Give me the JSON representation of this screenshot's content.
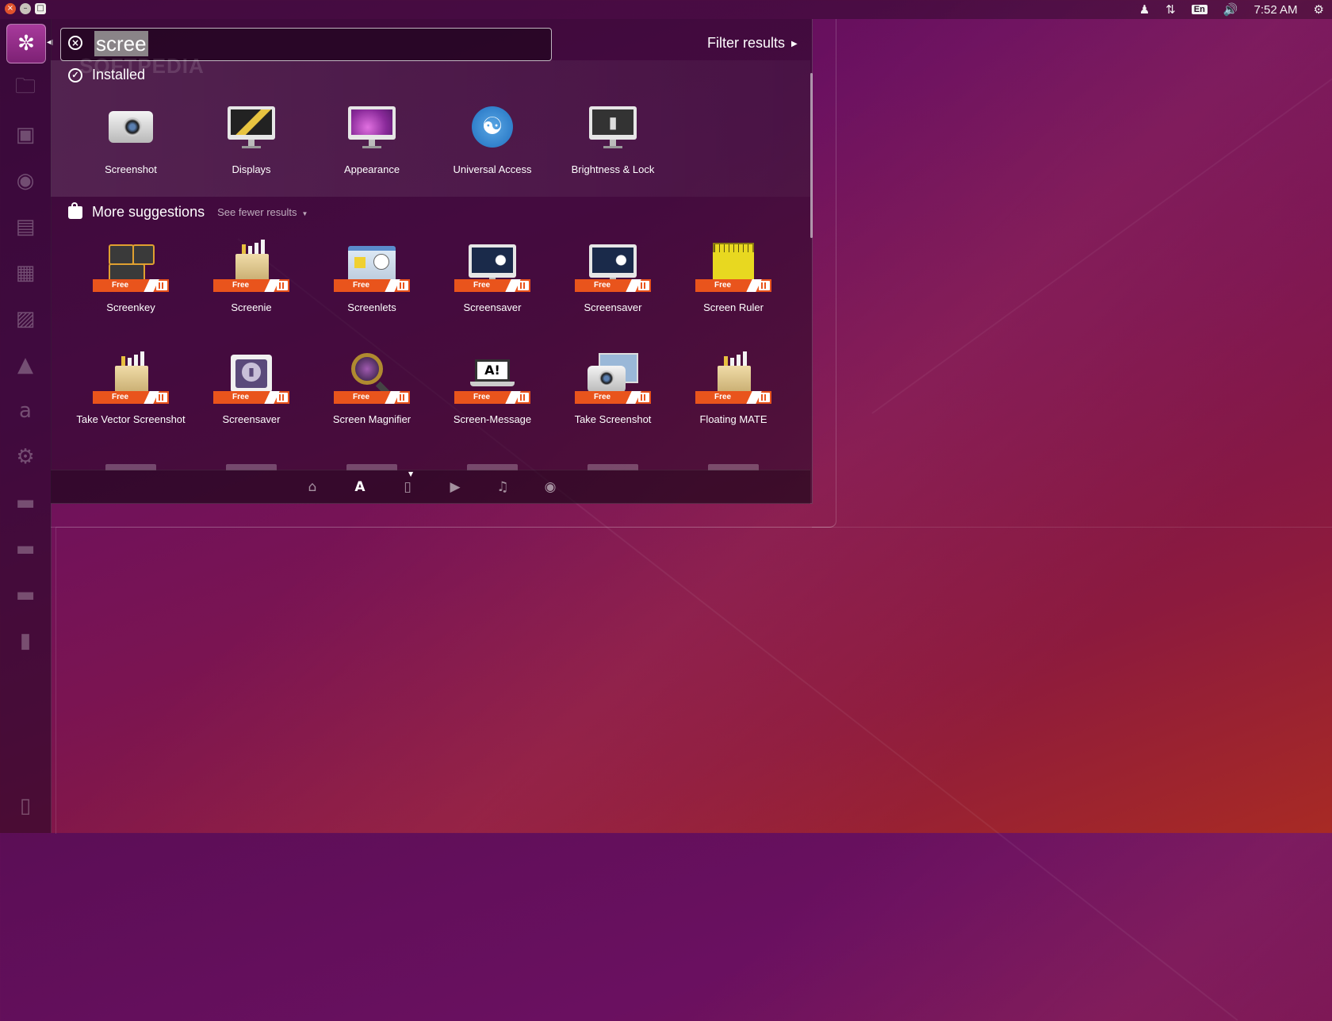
{
  "top_panel": {
    "clock": "7:52 AM",
    "keyboard_layout": "En",
    "indicators": [
      "user-icon",
      "network-icon",
      "keyboard-layout",
      "volume-icon",
      "clock",
      "session-gear-icon"
    ]
  },
  "launcher": {
    "items": [
      "ubuntu-dash-icon",
      "files-icon",
      "browser-icon",
      "firefox-icon",
      "writer-icon",
      "calc-icon",
      "impress-icon",
      "software-center-icon",
      "amazon-icon",
      "system-settings-icon",
      "drive-icon",
      "drive-icon",
      "drive-icon",
      "usb-icon",
      "trash-icon"
    ],
    "amazon_glyph": "a"
  },
  "dash": {
    "search_value": "scree",
    "filter_results_label": "Filter results",
    "watermark": "SOFTPEDIA",
    "installed": {
      "header": "Installed",
      "apps": [
        {
          "label": "Screenshot",
          "icon": "camera-icon"
        },
        {
          "label": "Displays",
          "icon": "displays-icon"
        },
        {
          "label": "Appearance",
          "icon": "appearance-icon"
        },
        {
          "label": "Universal Access",
          "icon": "universal-access-icon"
        },
        {
          "label": "Brightness & Lock",
          "icon": "brightness-lock-icon"
        }
      ]
    },
    "suggestions": {
      "header": "More suggestions",
      "see_fewer": "See fewer results",
      "free_label": "Free",
      "row1": [
        {
          "label": "Screenkey",
          "icon": "screenkey-icon"
        },
        {
          "label": "Screenie",
          "icon": "package-icon"
        },
        {
          "label": "Screenlets",
          "icon": "screenlets-icon"
        },
        {
          "label": "Screensaver",
          "icon": "screensaver-icon"
        },
        {
          "label": "Screensaver",
          "icon": "screensaver-icon"
        },
        {
          "label": "Screen Ruler",
          "icon": "ruler-icon"
        }
      ],
      "row2": [
        {
          "label": "Take Vector Screenshot",
          "icon": "package-icon"
        },
        {
          "label": "Screensaver",
          "icon": "lock-screensaver-icon"
        },
        {
          "label": "Screen Magnifier",
          "icon": "magnifier-icon"
        },
        {
          "label": "Screen-Message",
          "icon": "screen-message-icon"
        },
        {
          "label": "Take Screenshot",
          "icon": "camera-icon"
        },
        {
          "label": "Floating MATE",
          "icon": "package-icon"
        }
      ]
    },
    "lenses": [
      "home-icon",
      "applications-icon",
      "files-icon",
      "video-icon",
      "music-icon",
      "photos-icon"
    ],
    "active_lens": "applications-icon"
  }
}
